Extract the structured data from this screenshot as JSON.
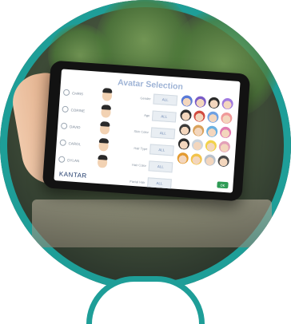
{
  "screen": {
    "title": "Avatar Selection",
    "logo": "KANTAR",
    "ok_label": "OK"
  },
  "left_rows": [
    {
      "label": "CHRIS"
    },
    {
      "label": "CORINE"
    },
    {
      "label": "DAVID"
    },
    {
      "label": "CAROL"
    },
    {
      "label": "DYLAN"
    }
  ],
  "attributes": [
    {
      "label": "Gender",
      "value": "ALL"
    },
    {
      "label": "Age",
      "value": "ALL"
    },
    {
      "label": "Skin Color",
      "value": "ALL"
    },
    {
      "label": "Hair Type",
      "value": "ALL"
    },
    {
      "label": "Hair Color",
      "value": "ALL"
    },
    {
      "label": "Facial Hair",
      "value": "ALL"
    }
  ],
  "avatar_colors": [
    "#5a7bd8",
    "#7a5cc7",
    "#2b2b2b",
    "#a07adf",
    "#2f2f2f",
    "#d14b3f",
    "#6fa1e3",
    "#f09a9a",
    "#3a3a3a",
    "#d9a15a",
    "#6ab0e0",
    "#e07ab0",
    "#2b2b2b",
    "#cbd4dd",
    "#f2d24a",
    "#e3a0b8",
    "#e39a2f",
    "#f2c34a",
    "#b9c2cc",
    "#4a4a4a"
  ],
  "colors": {
    "accent_ring": "#1e9e98",
    "title_color": "#9fb4d6",
    "ok_green": "#2e9b55"
  }
}
